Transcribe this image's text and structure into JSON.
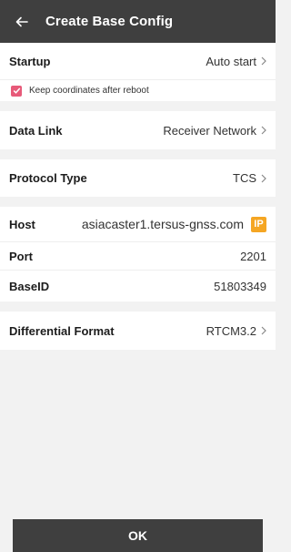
{
  "header": {
    "title": "Create Base Config",
    "back_icon": "arrow-left-icon"
  },
  "startup": {
    "label": "Startup",
    "value": "Auto start"
  },
  "keep_coords": {
    "label": "Keep coordinates after reboot",
    "checked": true,
    "check_color": "#e75a79"
  },
  "data_link": {
    "label": "Data Link",
    "value": "Receiver Network"
  },
  "protocol": {
    "label": "Protocol Type",
    "value": "TCS"
  },
  "host": {
    "label": "Host",
    "value": "asiacaster1.tersus-gnss.com",
    "badge": "IP",
    "badge_color": "#f5a623"
  },
  "port": {
    "label": "Port",
    "value": "2201"
  },
  "base_id": {
    "label": "BaseID",
    "value": "51803349"
  },
  "diff_format": {
    "label": "Differential Format",
    "value": "RTCM3.2"
  },
  "ok_button": {
    "label": "OK"
  }
}
